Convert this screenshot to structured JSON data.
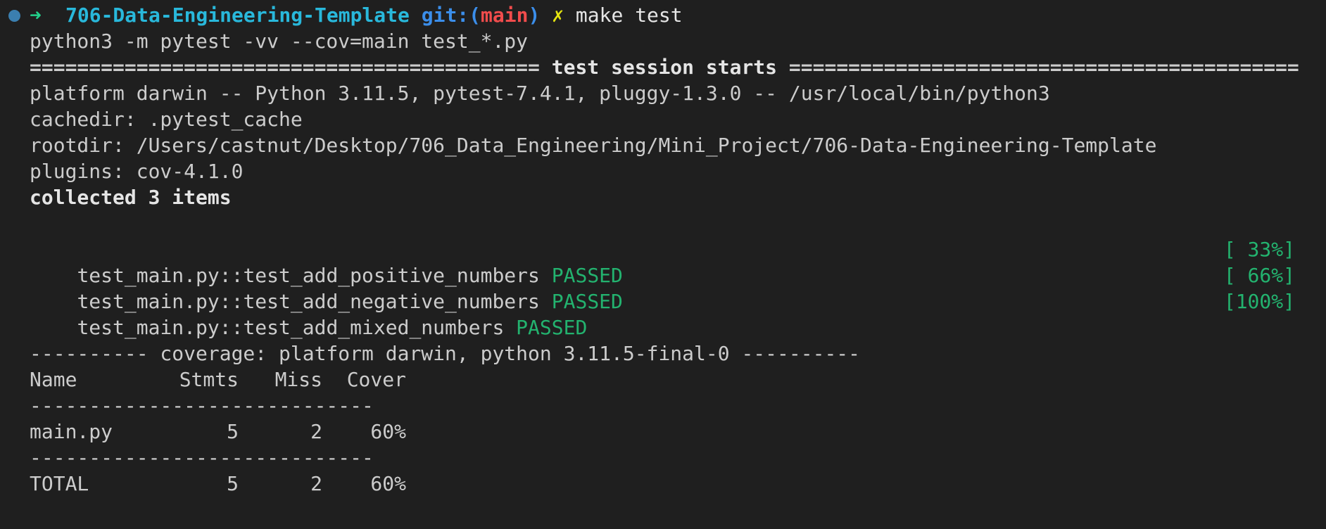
{
  "colors": {
    "background": "#1f1f1f",
    "text": "#cccccc",
    "dot": "#3b8eea",
    "arrow": "#23d18b",
    "dir": "#29b8db",
    "git_label": "#3b8eea",
    "branch": "#f14c4c",
    "dirty_mark": "#e5e510",
    "passed": "#23b36f"
  },
  "prompt": {
    "arrow": "➜",
    "directory": "706-Data-Engineering-Template",
    "git_prefix": "git:(",
    "branch": "main",
    "git_suffix": ")",
    "dirty_mark": "✗",
    "command": "make test"
  },
  "output": {
    "invocation": "python3 -m pytest -vv --cov=main test_*.py",
    "session_rule_left": "===========================================",
    "session_title": "test session starts",
    "session_rule_right": "===========================================",
    "platform": "platform darwin -- Python 3.11.5, pytest-7.4.1, pluggy-1.3.0 -- /usr/local/bin/python3",
    "cachedir": "cachedir: .pytest_cache",
    "rootdir": "rootdir: /Users/castnut/Desktop/706_Data_Engineering/Mini_Project/706-Data-Engineering-Template",
    "plugins": "plugins: cov-4.1.0",
    "collected": "collected 3 items"
  },
  "tests": [
    {
      "name": "test_main.py::test_add_positive_numbers",
      "status": "PASSED",
      "progress": "[ 33%]"
    },
    {
      "name": "test_main.py::test_add_negative_numbers",
      "status": "PASSED",
      "progress": "[ 66%]"
    },
    {
      "name": "test_main.py::test_add_mixed_numbers",
      "status": "PASSED",
      "progress": "[100%]"
    }
  ],
  "coverage": {
    "header": "---------- coverage: platform darwin, python 3.11.5-final-0 ----------",
    "columns": [
      "Name",
      "Stmts",
      "Miss",
      "Cover"
    ],
    "rule": "-----------------------------",
    "rows": [
      {
        "name": "main.py",
        "stmts": "5",
        "miss": "2",
        "cover": "60%"
      }
    ],
    "total": {
      "name": "TOTAL",
      "stmts": "5",
      "miss": "2",
      "cover": "60%"
    }
  }
}
